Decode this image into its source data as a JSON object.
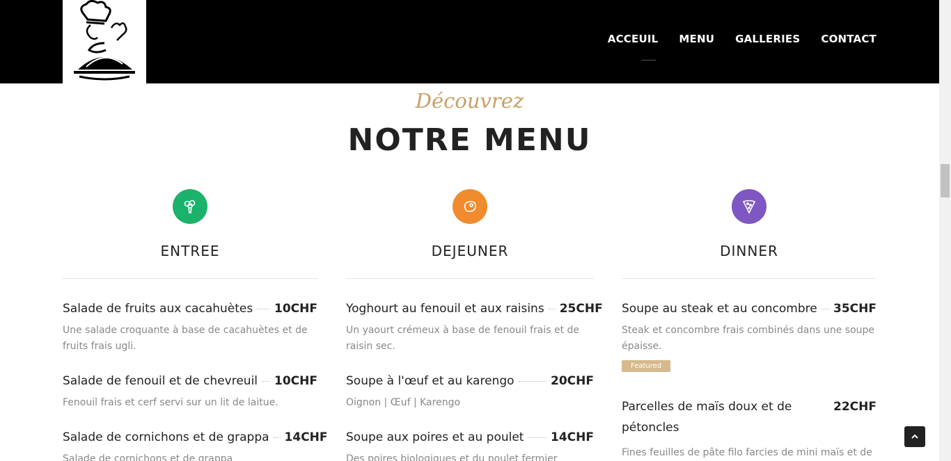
{
  "nav": {
    "items": [
      "ACCEUIL",
      "MENU",
      "GALLERIES",
      "CONTACT"
    ]
  },
  "hero": {
    "subtitle": "Découvrez",
    "title": "NOTRE MENU"
  },
  "colors": {
    "accent": "#c8a066",
    "entree": "#1bb26b",
    "dejeuner": "#f08c2e",
    "dinner": "#7e57c2",
    "badge": "#d6b98c"
  },
  "categories": [
    {
      "title": "ENTREE",
      "icon": "broccoli-icon",
      "items": [
        {
          "name": "Salade de fruits aux cacahuètes",
          "price": "10CHF",
          "desc": "Une salade croquante à base de cacahuètes et de fruits frais ugli."
        },
        {
          "name": "Salade de fenouil et de chevreuil",
          "price": "10CHF",
          "desc": "Fenouil frais et cerf servi sur un lit de laitue."
        },
        {
          "name": "Salade de cornichons et de grappa",
          "price": "14CHF",
          "desc": "Salade de cornichons et de grappa"
        }
      ]
    },
    {
      "title": "DEJEUNER",
      "icon": "steak-icon",
      "items": [
        {
          "name": "Yoghourt au fenouil et aux raisins",
          "price": "25CHF",
          "desc": "Un yaourt crémeux à base de fenouil frais et de raisin sec."
        },
        {
          "name": "Soupe à l'œuf et au karengo",
          "price": "20CHF",
          "desc": "Oignon | Œuf | Karengo"
        },
        {
          "name": "Soupe aux poires et au poulet",
          "price": "14CHF",
          "desc": "Des poires biologiques et du poulet fermier"
        }
      ]
    },
    {
      "title": "DINNER",
      "icon": "pizza-slice-icon",
      "items": [
        {
          "name": "Soupe au steak et au concombre",
          "price": "35CHF",
          "desc": "Steak et concombre frais combinés dans une soupe épaisse.",
          "badge": "Featured"
        },
        {
          "name": "Parcelles de maïs doux et de pétoncles",
          "price": "22CHF",
          "desc": "Fines feuilles de pâte filo farcies de mini maïs et de"
        }
      ]
    }
  ]
}
